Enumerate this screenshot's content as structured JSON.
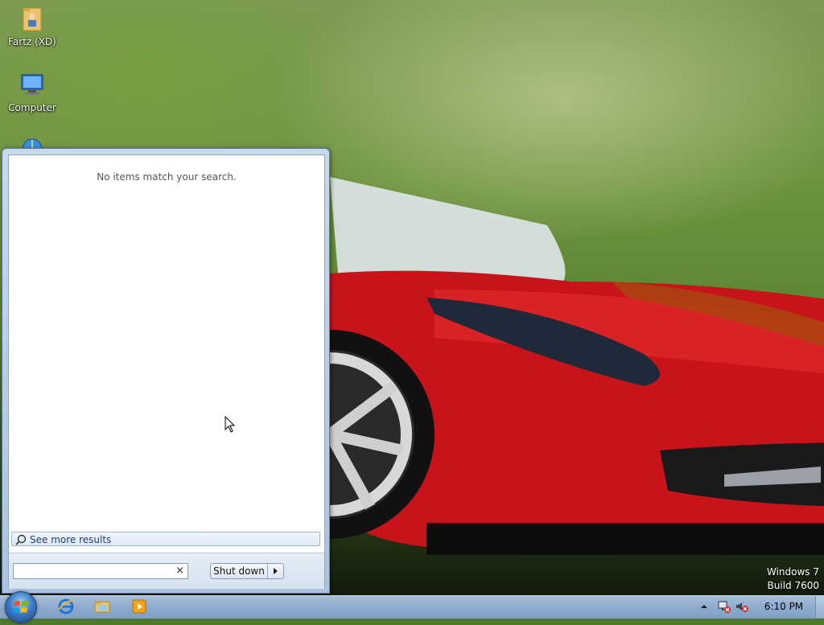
{
  "desktop": {
    "icons": [
      {
        "label": "Fartz (XD)",
        "icon": "folder-user-icon"
      },
      {
        "label": "Computer",
        "icon": "computer-icon"
      },
      {
        "label": "",
        "icon": "network-icon"
      }
    ],
    "watermark": {
      "line1": "Windows 7",
      "line2": "Build 7600"
    }
  },
  "start_menu": {
    "no_items_text": "No items match your search.",
    "see_more_results": "See more results",
    "search": {
      "value": "",
      "clear": "×"
    },
    "shutdown_label": "Shut down"
  },
  "taskbar": {
    "pinned": [
      "internet-explorer-icon",
      "windows-explorer-icon",
      "media-player-icon"
    ],
    "tray": [
      "show-hidden-icons-icon",
      "network-icon",
      "volume-muted-icon"
    ],
    "clock": "6:10 PM"
  },
  "colors": {
    "taskbar": "#90add0",
    "start_menu": "#aac3df",
    "accent": "#1c3e6e"
  }
}
